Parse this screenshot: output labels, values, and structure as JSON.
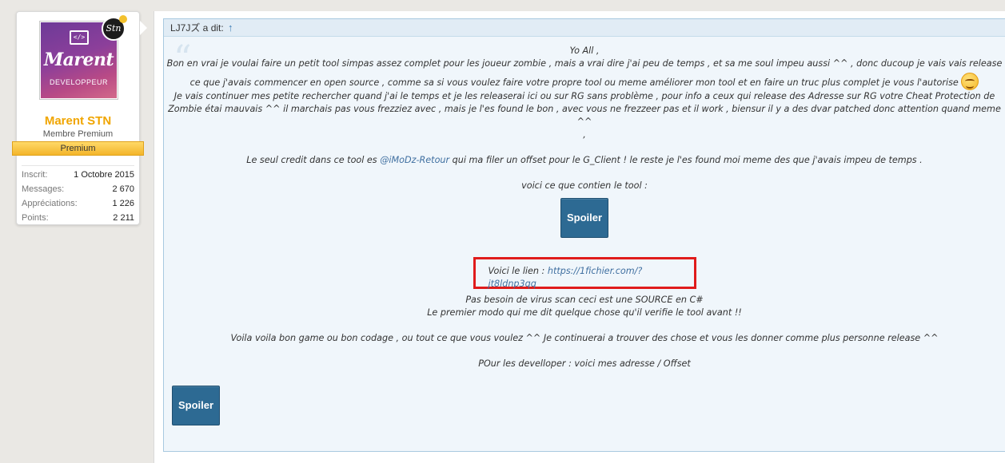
{
  "user": {
    "avatar_code": "</>",
    "avatar_brand": "Marent",
    "avatar_sub": "DEVELOPPEUR",
    "badge_text": "Stn",
    "name": "Marent STN",
    "title": "Membre Premium",
    "ribbon": "Premium",
    "stats": [
      {
        "label": "Inscrit:",
        "value": "1 Octobre 2015"
      },
      {
        "label": "Messages:",
        "value": "2 670"
      },
      {
        "label": "Appréciations:",
        "value": "1 226"
      },
      {
        "label": "Points:",
        "value": "2 211"
      }
    ]
  },
  "quote": {
    "author": "LJ7Jズ a dit:",
    "jump": "↑",
    "lines": {
      "l1": "Yo All ,",
      "l2": "Bon en vrai je voulai faire un petit tool simpas assez complet pour les joueur zombie , mais a vrai dire j'ai peu de temps , et sa me soul impeu aussi ^^ , donc ducoup je vais vais release",
      "l3": "ce que j'avais commencer en open source , comme sa si vous voulez faire votre propre tool ou meme améliorer mon tool et en faire un truc plus complet je vous l'autorise",
      "l4": "Je vais continuer mes petite rechercher quand j'ai le temps et je les releaserai ici ou sur RG sans problème , pour info a ceux qui release des Adresse sur RG votre Cheat Protection de",
      "l5": "Zombie étai mauvais ^^ il marchais pas vous frezziez avec , mais je l'es found le bon , avec vous ne frezzeer pas et il work , biensur il y a des dvar patched donc attention quand meme ^^",
      "l6": ",",
      "credit_pre": "Le seul credit dans ce tool es",
      "credit_user": "@iMoDz-Retour",
      "credit_post": "qui ma filer un offset pour le G_Client ! le reste je l'es found moi meme des que j'avais impeu de temps .",
      "contents": "voici ce que contien le tool :",
      "spoiler": "Spoiler",
      "link_label": "Voici le lien :",
      "link_url": "https://1fichier.com/?jt8ldnp3qq",
      "virus": "Pas besoin de virus scan ceci est une SOURCE en C#",
      "modo": "Le premier modo qui me dit quelque chose qu'il verifie le tool avant !!",
      "voila": "Voila voila bon game ou bon codage , ou tout ce que vous voulez ^^ Je continuerai a trouver des chose et vous les donner comme plus personne release ^^",
      "devs": "POur les develloper : voici mes adresse / Offset"
    },
    "spoiler_bottom": "Spoiler"
  },
  "colors": {
    "username": "#f0a500",
    "quote_bg": "#f0f6fb",
    "highlight_border": "#e01b1b",
    "spoiler_bg": "#2d6a93"
  }
}
